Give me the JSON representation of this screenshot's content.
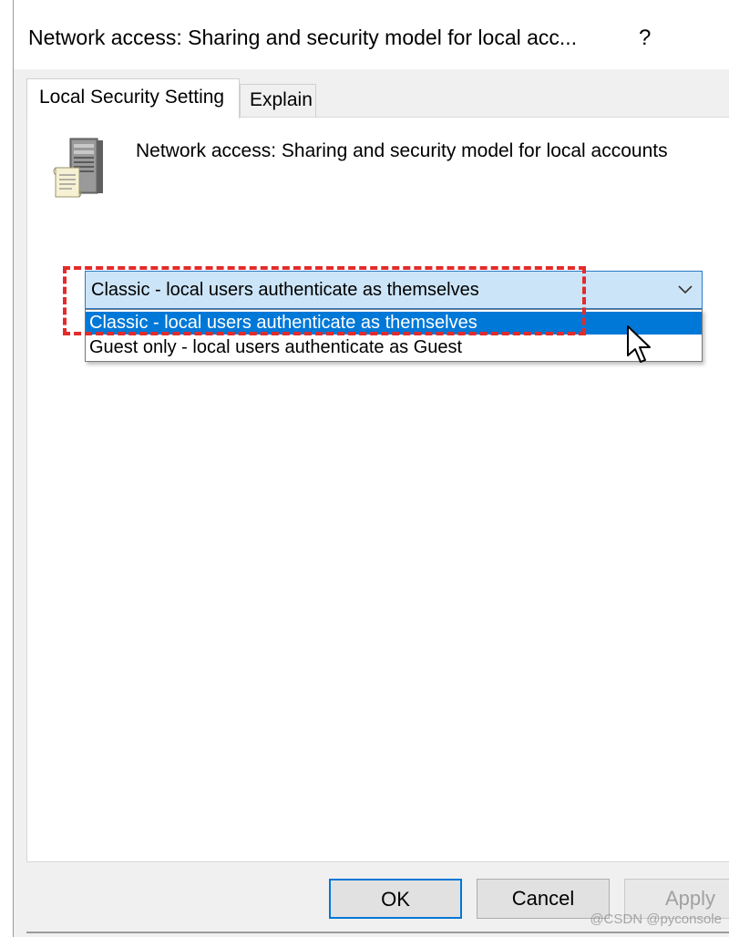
{
  "window": {
    "title": "Network access: Sharing and security model for local acc...",
    "help_label": "?"
  },
  "tabs": [
    {
      "label": "Local Security Setting",
      "active": true
    },
    {
      "label": "Explain",
      "active": false
    }
  ],
  "policy": {
    "icon": "server-document-icon",
    "description": "Network access: Sharing and security model for local accounts"
  },
  "combo": {
    "selected": "Classic - local users authenticate as themselves",
    "chevron_icon": "chevron-down-icon",
    "options": [
      {
        "label": "Classic - local users authenticate as themselves",
        "highlighted": true
      },
      {
        "label": "Guest only - local users authenticate as Guest",
        "highlighted": false
      }
    ]
  },
  "buttons": {
    "ok": "OK",
    "cancel": "Cancel",
    "apply": "Apply"
  },
  "watermark": "@CSDN @pyconsole",
  "colors": {
    "highlight_border": "#e32b2b",
    "selection_bg": "#0078d7",
    "combo_bg": "#cce4f7"
  }
}
